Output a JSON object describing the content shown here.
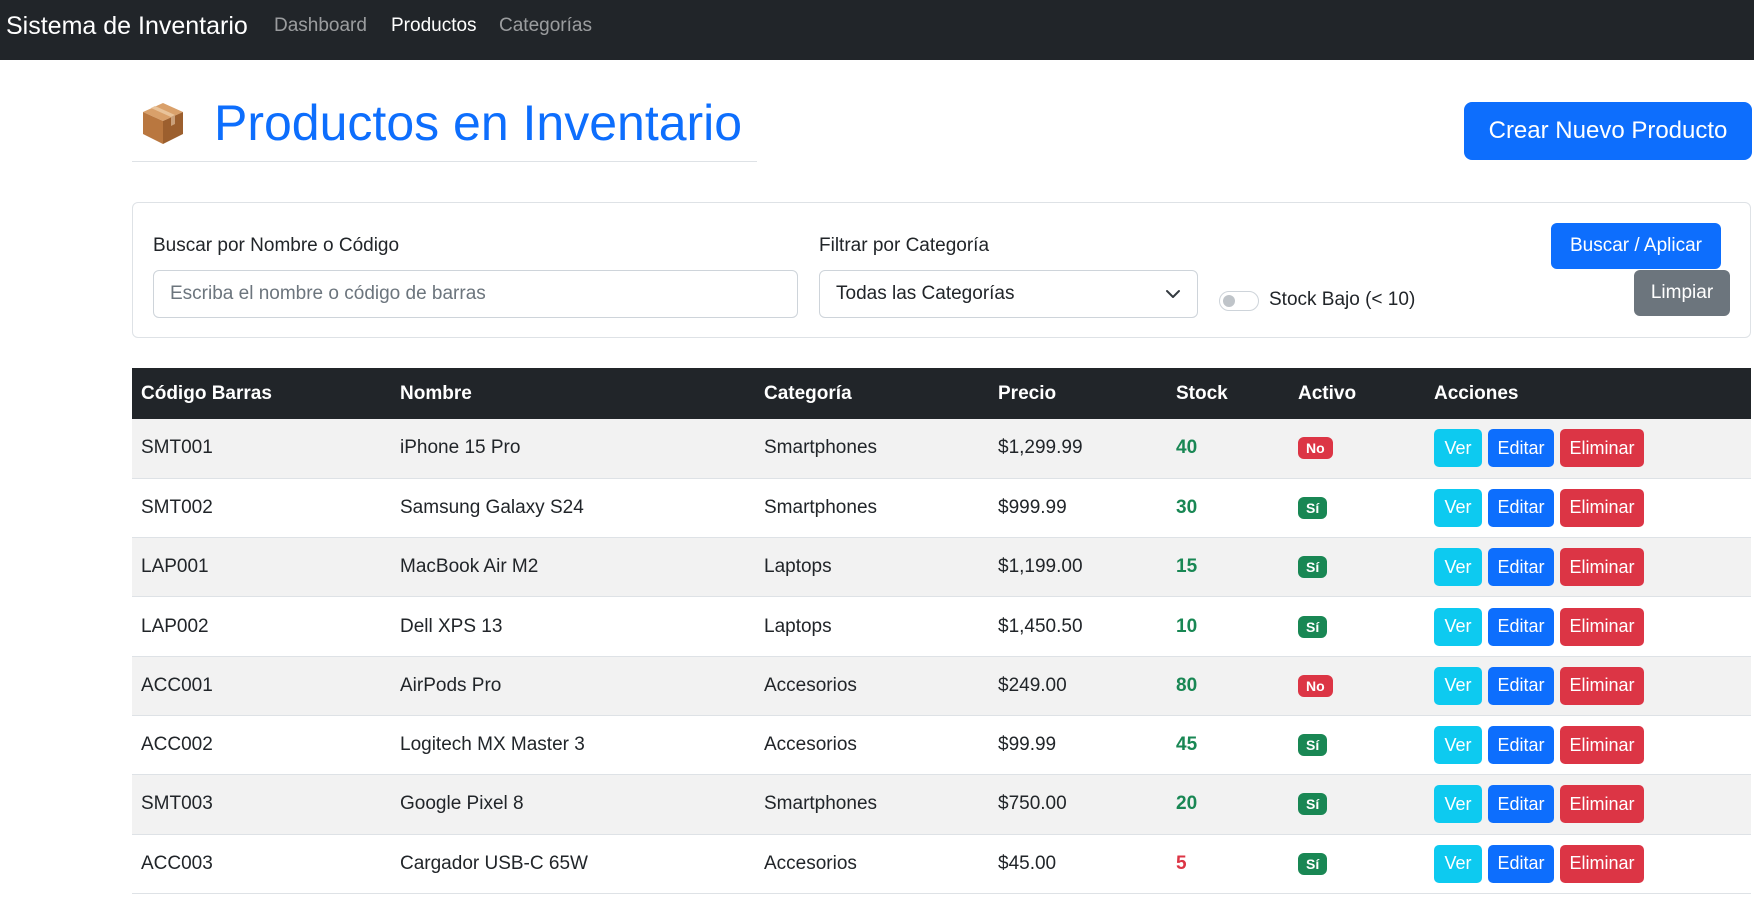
{
  "navbar": {
    "brand": "Sistema de Inventario",
    "links": [
      {
        "label": "Dashboard",
        "active": false
      },
      {
        "label": "Productos",
        "active": true
      },
      {
        "label": "Categorías",
        "active": false
      }
    ]
  },
  "header": {
    "icon": "package-box-icon",
    "title": "Productos en Inventario",
    "create_button": "Crear Nuevo Producto"
  },
  "filters": {
    "search_label": "Buscar por Nombre o Código",
    "search_placeholder": "Escriba el nombre o código de barras",
    "search_value": "",
    "category_label": "Filtrar por Categoría",
    "category_selected": "Todas las Categorías",
    "low_stock_label": "Stock Bajo (< 10)",
    "low_stock_checked": false,
    "search_button": "Buscar / Aplicar",
    "clear_button": "Limpiar"
  },
  "table": {
    "columns": [
      "Código Barras",
      "Nombre",
      "Categoría",
      "Precio",
      "Stock",
      "Activo",
      "Acciones"
    ],
    "actions": {
      "view": "Ver",
      "edit": "Editar",
      "delete": "Eliminar"
    },
    "rows": [
      {
        "code": "SMT001",
        "name": "iPhone 15 Pro",
        "category": "Smartphones",
        "price": "$1,299.99",
        "stock": "40",
        "low": false,
        "active": "No",
        "is_active": false
      },
      {
        "code": "SMT002",
        "name": "Samsung Galaxy S24",
        "category": "Smartphones",
        "price": "$999.99",
        "stock": "30",
        "low": false,
        "active": "Sí",
        "is_active": true
      },
      {
        "code": "LAP001",
        "name": "MacBook Air M2",
        "category": "Laptops",
        "price": "$1,199.00",
        "stock": "15",
        "low": false,
        "active": "Sí",
        "is_active": true
      },
      {
        "code": "LAP002",
        "name": "Dell XPS 13",
        "category": "Laptops",
        "price": "$1,450.50",
        "stock": "10",
        "low": false,
        "active": "Sí",
        "is_active": true
      },
      {
        "code": "ACC001",
        "name": "AirPods Pro",
        "category": "Accesorios",
        "price": "$249.00",
        "stock": "80",
        "low": false,
        "active": "No",
        "is_active": false
      },
      {
        "code": "ACC002",
        "name": "Logitech MX Master 3",
        "category": "Accesorios",
        "price": "$99.99",
        "stock": "45",
        "low": false,
        "active": "Sí",
        "is_active": true
      },
      {
        "code": "SMT003",
        "name": "Google Pixel 8",
        "category": "Smartphones",
        "price": "$750.00",
        "stock": "20",
        "low": false,
        "active": "Sí",
        "is_active": true
      },
      {
        "code": "ACC003",
        "name": "Cargador USB-C 65W",
        "category": "Accesorios",
        "price": "$45.00",
        "stock": "5",
        "low": true,
        "active": "Sí",
        "is_active": true
      }
    ]
  },
  "colors": {
    "navbar_bg": "#212529",
    "primary": "#0d6efd",
    "info": "#0dcaf0",
    "danger": "#dc3545",
    "success": "#198754",
    "secondary": "#6c757d"
  }
}
